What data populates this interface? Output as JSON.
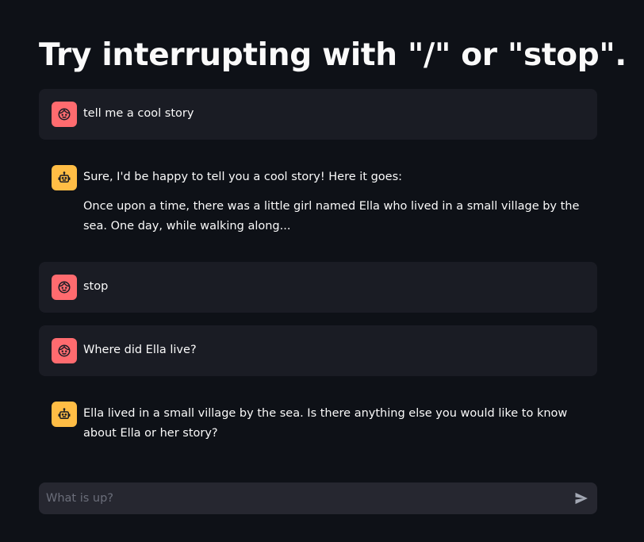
{
  "page": {
    "title": "Try interrupting with \"/\" or \"stop\"."
  },
  "messages": [
    {
      "role": "user",
      "avatar_icon": "user-face-icon",
      "paragraphs": [
        "tell me a cool story"
      ]
    },
    {
      "role": "assistant",
      "avatar_icon": "robot-icon",
      "paragraphs": [
        "Sure, I'd be happy to tell you a cool story! Here it goes:",
        "Once upon a time, there was a little girl named Ella who lived in a small village by the sea. One day, while walking along..."
      ]
    },
    {
      "role": "user",
      "avatar_icon": "user-face-icon",
      "paragraphs": [
        "stop"
      ]
    },
    {
      "role": "user",
      "avatar_icon": "user-face-icon",
      "paragraphs": [
        "Where did Ella live?"
      ]
    },
    {
      "role": "assistant",
      "avatar_icon": "robot-icon",
      "paragraphs": [
        "Ella lived in a small village by the sea. Is there anything else you would like to know about Ella or her story?"
      ]
    }
  ],
  "chat_input": {
    "placeholder": "What is up?",
    "value": "",
    "send_icon": "send-icon"
  },
  "colors": {
    "background": "#0e1117",
    "user_message_bg": "#1a1c24",
    "user_avatar": "#ff6b6f",
    "assistant_avatar": "#ffbd45",
    "input_bg": "#262730"
  }
}
